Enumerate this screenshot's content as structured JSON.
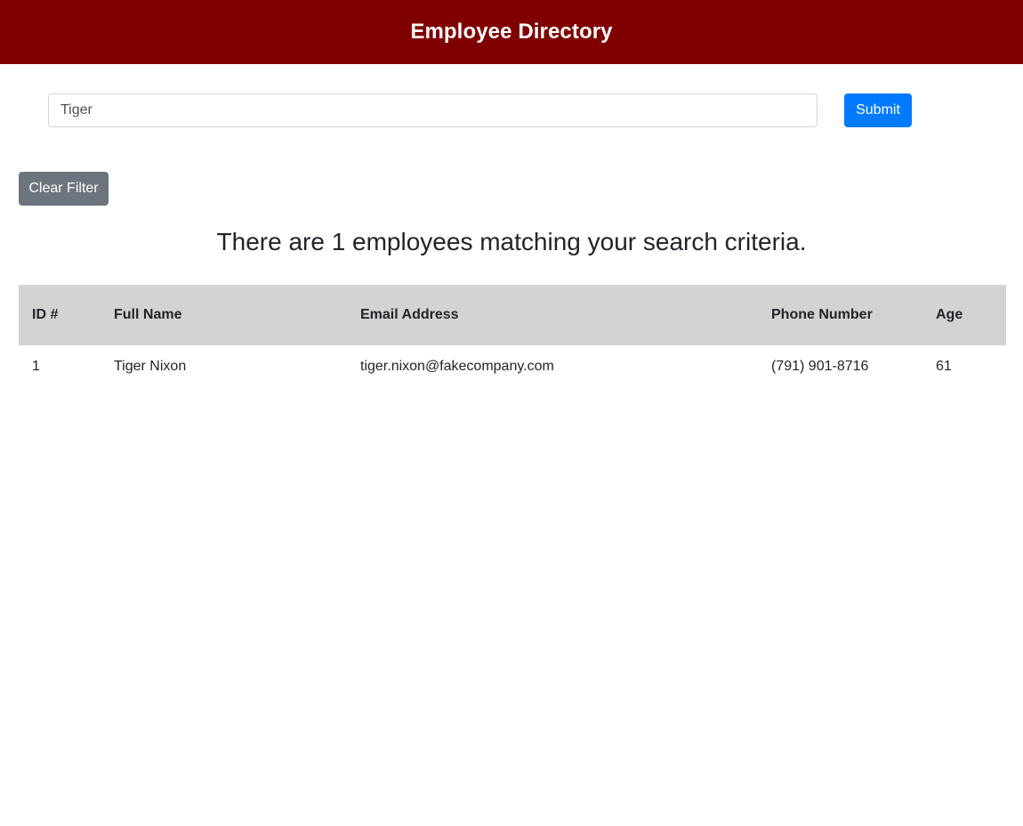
{
  "header": {
    "title": "Employee Directory"
  },
  "search": {
    "value": "Tiger",
    "submit_label": "Submit"
  },
  "filter": {
    "clear_label": "Clear Filter"
  },
  "results": {
    "message": "There are 1 employees matching your search criteria."
  },
  "table": {
    "columns": [
      "ID #",
      "Full Name",
      "Email Address",
      "Phone Number",
      "Age"
    ],
    "rows": [
      {
        "id": "1",
        "name": "Tiger Nixon",
        "email": "tiger.nixon@fakecompany.com",
        "phone": "(791) 901-8716",
        "age": "61"
      }
    ]
  },
  "colors": {
    "header_bg": "#800000",
    "submit_bg": "#007bff",
    "clear_bg": "#6c757d",
    "table_header_bg": "#d3d3d3"
  }
}
